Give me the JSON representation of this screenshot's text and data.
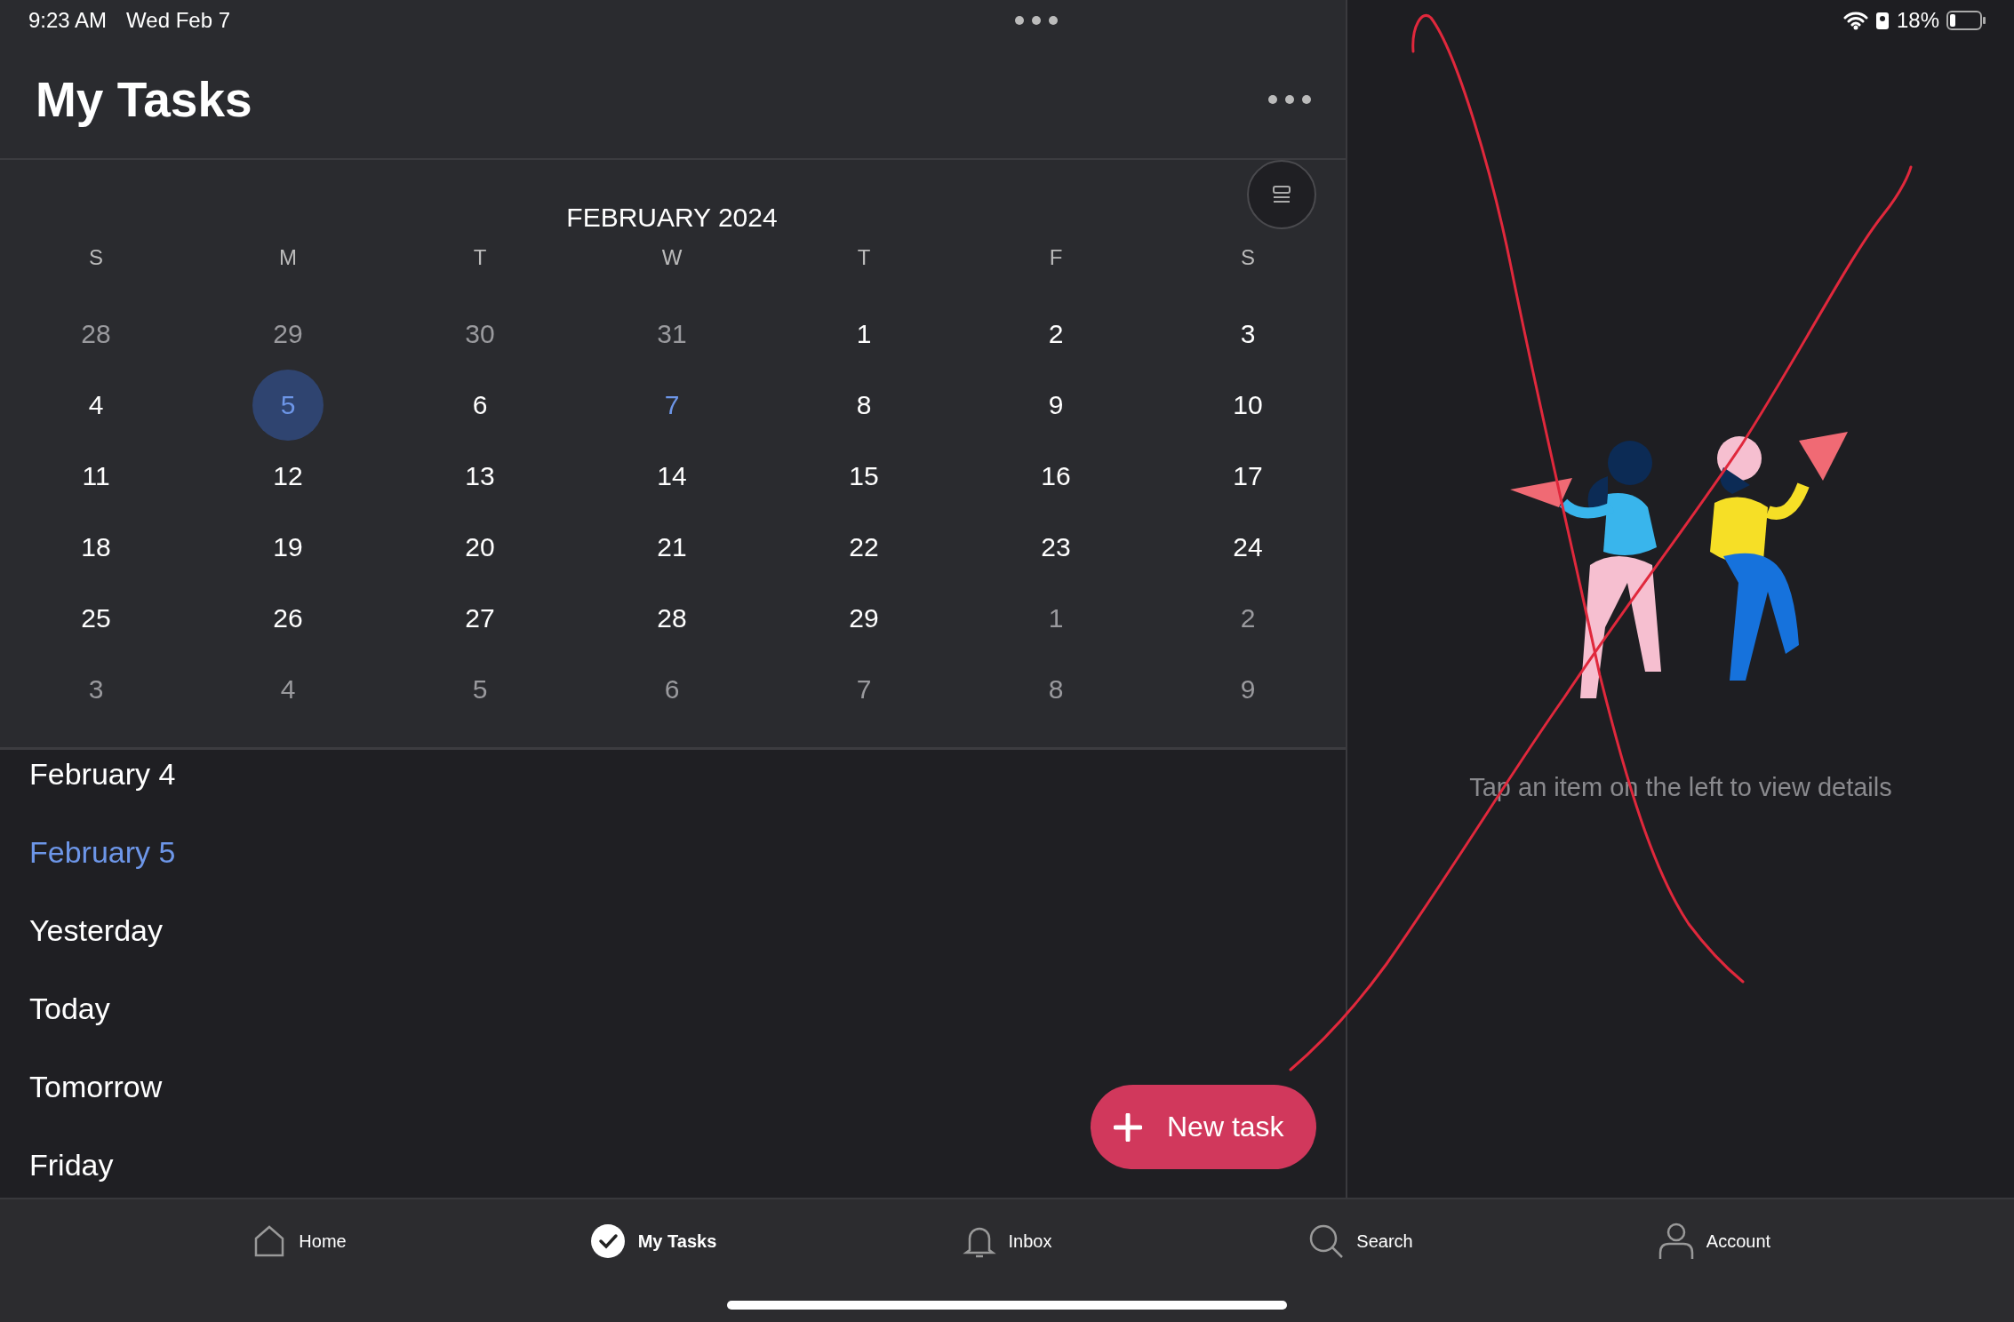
{
  "status_bar": {
    "time": "9:23 AM",
    "date": "Wed Feb 7",
    "battery": "18%"
  },
  "header": {
    "title": "My Tasks"
  },
  "calendar": {
    "month": "FEBRUARY 2024",
    "weekdays": [
      "S",
      "M",
      "T",
      "W",
      "T",
      "F",
      "S"
    ],
    "weeks": [
      [
        {
          "day": "28",
          "outside": true,
          "selected": false,
          "today": false
        },
        {
          "day": "29",
          "outside": true,
          "selected": false,
          "today": false
        },
        {
          "day": "30",
          "outside": true,
          "selected": false,
          "today": false
        },
        {
          "day": "31",
          "outside": true,
          "selected": false,
          "today": false
        },
        {
          "day": "1",
          "outside": false,
          "selected": false,
          "today": false
        },
        {
          "day": "2",
          "outside": false,
          "selected": false,
          "today": false
        },
        {
          "day": "3",
          "outside": false,
          "selected": false,
          "today": false
        }
      ],
      [
        {
          "day": "4",
          "outside": false,
          "selected": false,
          "today": false
        },
        {
          "day": "5",
          "outside": false,
          "selected": true,
          "today": false
        },
        {
          "day": "6",
          "outside": false,
          "selected": false,
          "today": false
        },
        {
          "day": "7",
          "outside": false,
          "selected": false,
          "today": true
        },
        {
          "day": "8",
          "outside": false,
          "selected": false,
          "today": false
        },
        {
          "day": "9",
          "outside": false,
          "selected": false,
          "today": false
        },
        {
          "day": "10",
          "outside": false,
          "selected": false,
          "today": false
        }
      ],
      [
        {
          "day": "11",
          "outside": false,
          "selected": false,
          "today": false
        },
        {
          "day": "12",
          "outside": false,
          "selected": false,
          "today": false
        },
        {
          "day": "13",
          "outside": false,
          "selected": false,
          "today": false
        },
        {
          "day": "14",
          "outside": false,
          "selected": false,
          "today": false
        },
        {
          "day": "15",
          "outside": false,
          "selected": false,
          "today": false
        },
        {
          "day": "16",
          "outside": false,
          "selected": false,
          "today": false
        },
        {
          "day": "17",
          "outside": false,
          "selected": false,
          "today": false
        }
      ],
      [
        {
          "day": "18",
          "outside": false,
          "selected": false,
          "today": false
        },
        {
          "day": "19",
          "outside": false,
          "selected": false,
          "today": false
        },
        {
          "day": "20",
          "outside": false,
          "selected": false,
          "today": false
        },
        {
          "day": "21",
          "outside": false,
          "selected": false,
          "today": false
        },
        {
          "day": "22",
          "outside": false,
          "selected": false,
          "today": false
        },
        {
          "day": "23",
          "outside": false,
          "selected": false,
          "today": false
        },
        {
          "day": "24",
          "outside": false,
          "selected": false,
          "today": false
        }
      ],
      [
        {
          "day": "25",
          "outside": false,
          "selected": false,
          "today": false
        },
        {
          "day": "26",
          "outside": false,
          "selected": false,
          "today": false
        },
        {
          "day": "27",
          "outside": false,
          "selected": false,
          "today": false
        },
        {
          "day": "28",
          "outside": false,
          "selected": false,
          "today": false
        },
        {
          "day": "29",
          "outside": false,
          "selected": false,
          "today": false
        },
        {
          "day": "1",
          "outside": true,
          "selected": false,
          "today": false
        },
        {
          "day": "2",
          "outside": true,
          "selected": false,
          "today": false
        }
      ],
      [
        {
          "day": "3",
          "outside": true,
          "selected": false,
          "today": false
        },
        {
          "day": "4",
          "outside": true,
          "selected": false,
          "today": false
        },
        {
          "day": "5",
          "outside": true,
          "selected": false,
          "today": false
        },
        {
          "day": "6",
          "outside": true,
          "selected": false,
          "today": false
        },
        {
          "day": "7",
          "outside": true,
          "selected": false,
          "today": false
        },
        {
          "day": "8",
          "outside": true,
          "selected": false,
          "today": false
        },
        {
          "day": "9",
          "outside": true,
          "selected": false,
          "today": false
        }
      ]
    ]
  },
  "day_list": [
    {
      "label": "February 4",
      "selected": false
    },
    {
      "label": "February 5",
      "selected": true
    },
    {
      "label": "Yesterday",
      "selected": false
    },
    {
      "label": "Today",
      "selected": false
    },
    {
      "label": "Tomorrow",
      "selected": false
    },
    {
      "label": "Friday",
      "selected": false
    }
  ],
  "new_task_button": {
    "label": "New task"
  },
  "detail_pane": {
    "message": "Tap an item on the left to view details"
  },
  "tab_bar": [
    {
      "label": "Home",
      "kind": "home",
      "selected": false
    },
    {
      "label": "My Tasks",
      "kind": "check",
      "selected": true
    },
    {
      "label": "Inbox",
      "kind": "bell",
      "selected": false
    },
    {
      "label": "Search",
      "kind": "search",
      "selected": false
    },
    {
      "label": "Account",
      "kind": "person",
      "selected": false
    }
  ]
}
